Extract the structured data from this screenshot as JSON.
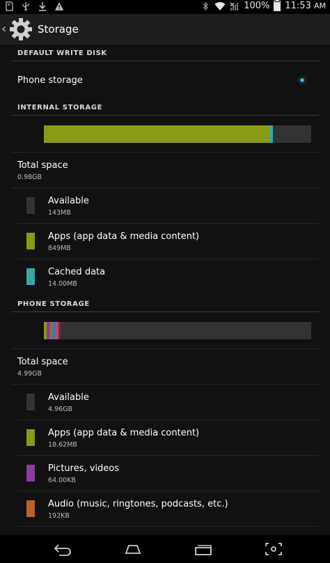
{
  "statusbar": {
    "battery_percent": "100%",
    "time": "11:53",
    "time_suffix": "AM",
    "left_icons": [
      "sd-card-icon",
      "usb-icon",
      "download-icon",
      "warning-icon"
    ],
    "right_icons": [
      "bluetooth-icon",
      "wifi-icon",
      "no-signal-icon",
      "battery-icon"
    ]
  },
  "actionbar": {
    "title": "Storage",
    "icon": "settings-gear-icon"
  },
  "default_write_disk": {
    "header": "DEFAULT WRITE DISK",
    "option_label": "Phone storage",
    "selected": true
  },
  "internal_storage": {
    "header": "INTERNAL STORAGE",
    "bar_segments": [
      {
        "name": "apps",
        "fraction": 0.844,
        "color": "#8a9a17"
      },
      {
        "name": "cached",
        "fraction": 0.014,
        "color": "#3aa6a6"
      },
      {
        "name": "available",
        "fraction": 0.142,
        "color": "#333333"
      }
    ],
    "total_label": "Total space",
    "total_value": "0.98GB",
    "items": [
      {
        "label": "Available",
        "value": "143MB",
        "color": "#333333"
      },
      {
        "label": "Apps (app data & media content)",
        "value": "849MB",
        "color": "#8a9a17"
      },
      {
        "label": "Cached data",
        "value": "14.00MB",
        "color": "#3aa6a6"
      }
    ]
  },
  "phone_storage": {
    "header": "PHONE STORAGE",
    "bar_segments": [
      {
        "name": "apps",
        "fraction": 0.011,
        "color": "#8a9a17"
      },
      {
        "name": "pictures",
        "fraction": 0.013,
        "color": "#8a3e9a"
      },
      {
        "name": "audio",
        "fraction": 0.008,
        "color": "#b5652b"
      },
      {
        "name": "downloads",
        "fraction": 0.01,
        "color": "#2f7fb0"
      },
      {
        "name": "misc",
        "fraction": 0.013,
        "color": "#c0487a"
      },
      {
        "name": "cached",
        "fraction": 0.008,
        "color": "#7a2c2c"
      },
      {
        "name": "available",
        "fraction": 0.937,
        "color": "#333333"
      }
    ],
    "total_label": "Total space",
    "total_value": "4.99GB",
    "items": [
      {
        "label": "Available",
        "value": "4.96GB",
        "color": "#333333"
      },
      {
        "label": "Apps (app data & media content)",
        "value": "18.62MB",
        "color": "#8a9a17"
      },
      {
        "label": "Pictures, videos",
        "value": "64.00KB",
        "color": "#8a3e9a"
      },
      {
        "label": "Audio (music, ringtones, podcasts, etc.)",
        "value": "192KB",
        "color": "#b5652b"
      }
    ]
  },
  "navbar": {
    "buttons": [
      "back-icon",
      "home-icon",
      "recent-apps-icon",
      "screenshot-icon"
    ]
  }
}
